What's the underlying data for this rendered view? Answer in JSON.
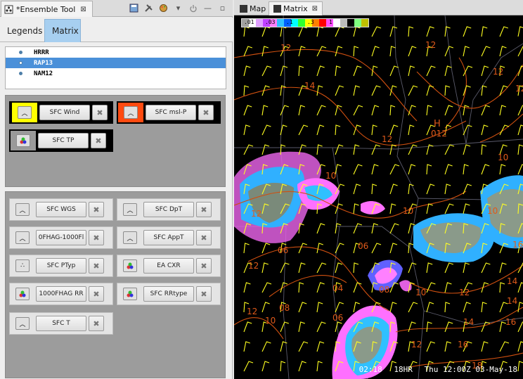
{
  "left_view": {
    "tab_title": "*Ensemble Tool",
    "close": "⊠",
    "subtabs": {
      "legends": "Legends",
      "matrix": "Matrix"
    }
  },
  "models": [
    {
      "name": "HRRR",
      "selected": false
    },
    {
      "name": "RAP13",
      "selected": true
    },
    {
      "name": "NAM12",
      "selected": false
    }
  ],
  "active_group": [
    {
      "label": "SFC Wind",
      "color": "#ffff00"
    },
    {
      "label": "SFC msl-P",
      "color": "#ff4a10"
    },
    {
      "label": "SFC TP",
      "color": "#9a9a9a"
    }
  ],
  "available_group": [
    {
      "label": "SFC WGS"
    },
    {
      "label": "SFC DpT"
    },
    {
      "label": "0FHAG-1000Fl"
    },
    {
      "label": "SFC AppT"
    },
    {
      "label": "SFC PTyp"
    },
    {
      "label": "EA CXR"
    },
    {
      "label": "1000FHAG RR"
    },
    {
      "label": "SFC RRtype"
    },
    {
      "label": "SFC T"
    }
  ],
  "right_view": {
    "tabs": {
      "map": "Map",
      "matrix": "Matrix"
    },
    "close": "⊠"
  },
  "colorbar": {
    "labels": [
      ".01",
      ".03",
      ".1",
      ".3",
      "1",
      "3",
      "10"
    ],
    "colors": [
      "#a0a0a0",
      "#ffffff",
      "#e0a0ff",
      "#c040ff",
      "#ff80ff",
      "#30c0ff",
      "#0060ff",
      "#00ffff",
      "#30ff30",
      "#ffff00",
      "#ff8000",
      "#ff0000",
      "#ff50ff",
      "#ffffff",
      "#bbbbbb",
      "#000000",
      "#7fff7f",
      "#c0c000"
    ]
  },
  "map": {
    "high_label": "H",
    "high_value": "012",
    "isobar_labels": [
      "12",
      "12",
      "12",
      "12",
      "14",
      "12",
      "10",
      "10",
      "10",
      "10",
      "06",
      "06",
      "04",
      "08",
      "12",
      "10",
      "06",
      "08",
      "10",
      "12",
      "14",
      "16",
      "14",
      "16",
      "18",
      "12",
      "14",
      "12",
      "12",
      "16"
    ]
  },
  "status": {
    "time": "02:18",
    "fhr": "18HR",
    "valid": "Thu 12:00Z 03-May-18"
  }
}
